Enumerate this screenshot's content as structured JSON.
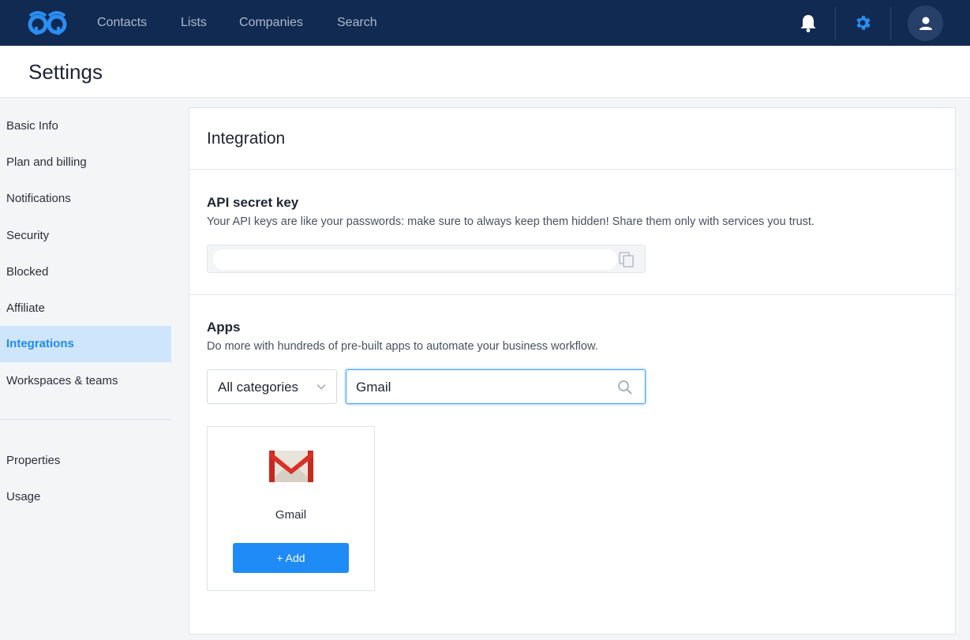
{
  "nav": {
    "links": [
      "Contacts",
      "Lists",
      "Companies",
      "Search"
    ]
  },
  "page": {
    "title": "Settings"
  },
  "sidebar": {
    "items": [
      "Basic Info",
      "Plan and billing",
      "Notifications",
      "Security",
      "Blocked",
      "Affiliate",
      "Integrations",
      "Workspaces & teams"
    ],
    "active": "Integrations",
    "secondary": [
      "Properties",
      "Usage"
    ]
  },
  "integration": {
    "title": "Integration",
    "api": {
      "title": "API secret key",
      "description": "Your API keys are like your passwords: make sure to always keep them hidden! Share them only with services you trust.",
      "value": ""
    },
    "apps": {
      "title": "Apps",
      "description": "Do more with hundreds of pre-built apps to automate your business workflow.",
      "category_selected": "All categories",
      "search_value": "Gmail",
      "items": [
        {
          "name": "Gmail",
          "button": "+ Add"
        }
      ]
    }
  },
  "colors": {
    "nav_bg": "#112a52",
    "accent": "#1e8bf6",
    "active_bg": "#cfe5fb"
  },
  "icons": [
    "logo-icon",
    "bell-icon",
    "gear-icon",
    "user-icon",
    "copy-icon",
    "chevron-down-icon",
    "search-icon",
    "gmail-icon"
  ]
}
